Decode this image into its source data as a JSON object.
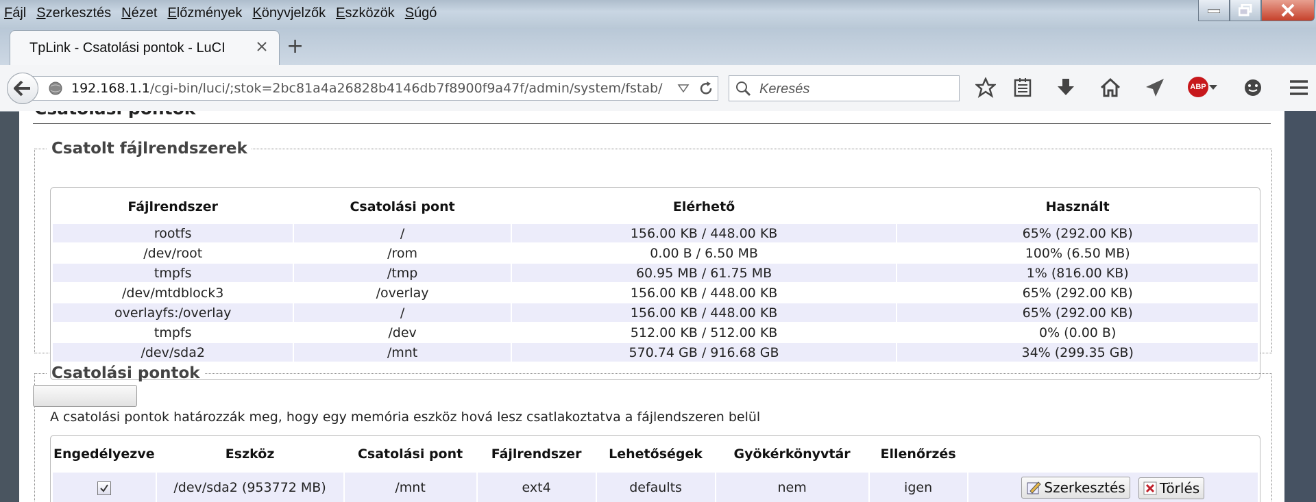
{
  "menu": [
    "Fájl",
    "Szerkesztés",
    "Nézet",
    "Előzmények",
    "Könyvjelzők",
    "Eszközök",
    "Súgó"
  ],
  "tab": {
    "title": "TpLink - Csatolási pontok - LuCI",
    "new_tab": "+"
  },
  "nav": {
    "url_host": "192.168.1.1",
    "url_path": "/cgi-bin/luci/;stok=2bc81a4a26828b4146db7f8900f9a47f/admin/system/fstab/",
    "search_placeholder": "Keresés",
    "abp_label": "ABP"
  },
  "page": {
    "heading": "Csatolási pontok",
    "mounted": {
      "legend": "Csatolt fájlrendszerek",
      "headers": [
        "Fájlrendszer",
        "Csatolási pont",
        "Elérhető",
        "Használt"
      ],
      "rows": [
        [
          "rootfs",
          "/",
          "156.00 KB / 448.00 KB",
          "65% (292.00 KB)"
        ],
        [
          "/dev/root",
          "/rom",
          "0.00 B / 6.50 MB",
          "100% (6.50 MB)"
        ],
        [
          "tmpfs",
          "/tmp",
          "60.95 MB / 61.75 MB",
          "1% (816.00 KB)"
        ],
        [
          "/dev/mtdblock3",
          "/overlay",
          "156.00 KB / 448.00 KB",
          "65% (292.00 KB)"
        ],
        [
          "overlayfs:/overlay",
          "/",
          "156.00 KB / 448.00 KB",
          "65% (292.00 KB)"
        ],
        [
          "tmpfs",
          "/dev",
          "512.00 KB / 512.00 KB",
          "0% (0.00 B)"
        ],
        [
          "/dev/sda2",
          "/mnt",
          "570.74 GB / 916.68 GB",
          "34% (299.35 GB)"
        ]
      ]
    },
    "mountpoints": {
      "legend": "Csatolási pontok",
      "description": "A csatolási pontok határozzák meg, hogy egy memória eszköz hová lesz csatlakoztatva a fájlendszeren belül",
      "headers": [
        "Engedélyezve",
        "Eszköz",
        "Csatolási pont",
        "Fájlrendszer",
        "Lehetőségek",
        "Gyökérkönyvtár",
        "Ellenőrzés"
      ],
      "rows": [
        {
          "enabled": true,
          "device": "/dev/sda2 (953772 MB)",
          "mountpoint": "/mnt",
          "fs": "ext4",
          "options": "defaults",
          "root": "nem",
          "check": "igen"
        }
      ],
      "edit_label": "Szerkesztés",
      "delete_label": "Törlés"
    }
  }
}
